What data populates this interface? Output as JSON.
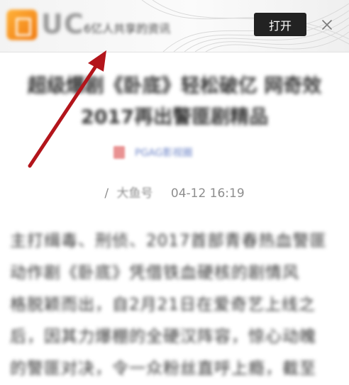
{
  "banner": {
    "brand_mark": "UC",
    "tagline": "6亿人共享的资讯",
    "open_label": "打开"
  },
  "article": {
    "title": "超级爆剧《卧底》轻松破亿 网奇效2017再出警匪剧精品",
    "author": "PGAG影视圈",
    "meta_prefix": "/",
    "source": "大鱼号",
    "timestamp": "04-12 16:19",
    "body_lines": [
      "主打缉毒、刑侦、2017首部青春热血警匪",
      "动作剧《卧底》凭借铁血硬核的剧情风",
      "格脱颖而出，自2月21日在爱奇艺上线之",
      "后，因其力爆棚的全硬汉阵容，惊心动魄",
      "的警匪对决，令一众粉丝直呼上瘾，截至"
    ]
  },
  "colors": {
    "open_button_bg": "#222222",
    "arrow": "#b3151b",
    "author_link": "#6f86c8"
  }
}
